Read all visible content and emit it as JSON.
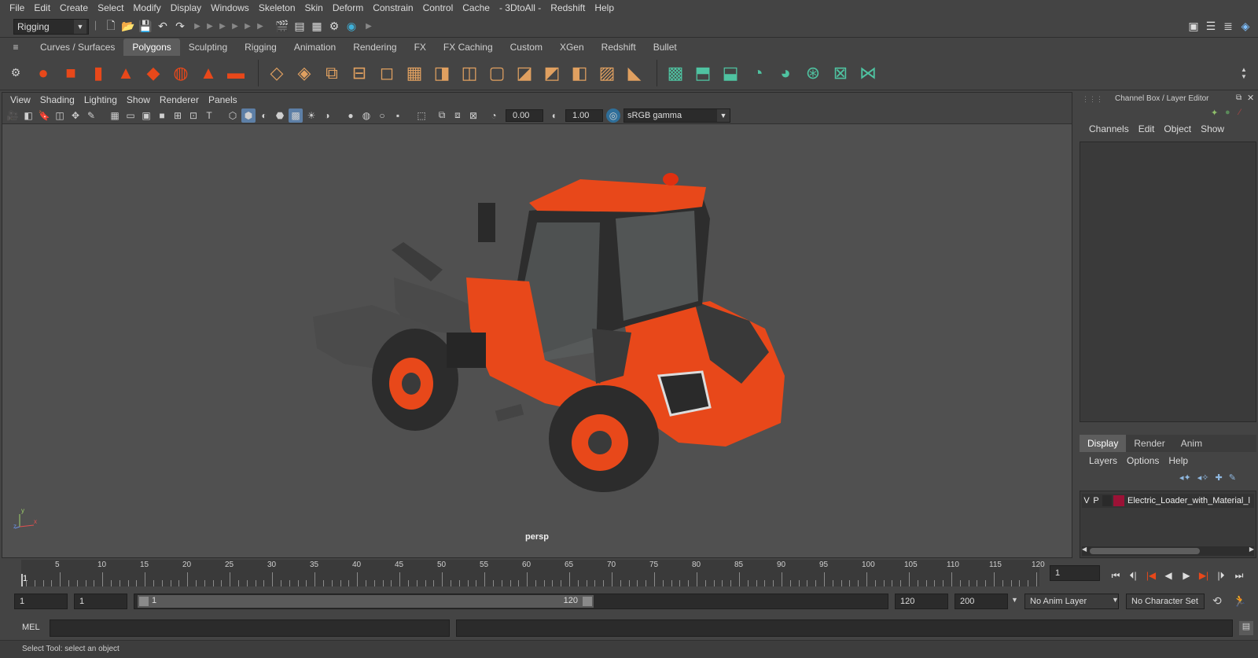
{
  "menubar": {
    "items": [
      "File",
      "Edit",
      "Create",
      "Select",
      "Modify",
      "Display",
      "Windows",
      "Skeleton",
      "Skin",
      "Deform",
      "Constrain",
      "Control",
      "Cache",
      "- 3DtoAll -",
      "Redshift",
      "Help"
    ]
  },
  "statusline": {
    "mode": "Rigging"
  },
  "shelf": {
    "tabs": [
      "Curves / Surfaces",
      "Polygons",
      "Sculpting",
      "Rigging",
      "Animation",
      "Rendering",
      "FX",
      "FX Caching",
      "Custom",
      "XGen",
      "Redshift",
      "Bullet"
    ],
    "active_tab": "Polygons",
    "icons": [
      "poly-sphere-icon",
      "poly-cube-icon",
      "poly-cylinder-icon",
      "poly-cone-icon",
      "poly-plane-icon",
      "poly-torus-icon",
      "poly-pyramid-icon",
      "poly-pipe-icon",
      "combine-icon",
      "separate-icon",
      "extrude-icon",
      "bridge-icon",
      "bevel-icon",
      "multi-cut-icon",
      "target-weld-icon",
      "edge-loop-icon",
      "merge-icon",
      "fill-hole-icon",
      "smooth-icon",
      "mirror-icon",
      "boolean-icon",
      "reduce-icon",
      "uv-editor-icon",
      "planar-map-icon",
      "cylindrical-map-icon",
      "spherical-map-icon",
      "automatic-map-icon",
      "unfold-icon",
      "layout-icon",
      "cut-sew-icon"
    ]
  },
  "viewport": {
    "menu": [
      "View",
      "Shading",
      "Lighting",
      "Show",
      "Renderer",
      "Panels"
    ],
    "exposure": "0.00",
    "gamma": "1.00",
    "colorspace": "sRGB gamma",
    "camera_label": "persp",
    "axis_y": "y",
    "axis_x": "x",
    "axis_z": "z"
  },
  "channelbox": {
    "title": "Channel Box / Layer Editor",
    "menu": [
      "Channels",
      "Edit",
      "Object",
      "Show"
    ]
  },
  "layer_editor": {
    "tabs": [
      "Display",
      "Render",
      "Anim"
    ],
    "active_tab": "Display",
    "menu": [
      "Layers",
      "Options",
      "Help"
    ],
    "layer": {
      "v": "V",
      "p": "P",
      "name": "Electric_Loader_with_Material_l",
      "color": "#9b1236"
    }
  },
  "timeline": {
    "ticks": [
      "5",
      "10",
      "15",
      "20",
      "25",
      "30",
      "35",
      "40",
      "45",
      "50",
      "55",
      "60",
      "65",
      "70",
      "75",
      "80",
      "85",
      "90",
      "95",
      "100",
      "105",
      "110",
      "115",
      "120"
    ],
    "start_marker": "1",
    "current_frame": "1"
  },
  "range": {
    "start": "1",
    "playback_start": "1",
    "slider_start": "1",
    "slider_end": "120",
    "playback_end": "120",
    "end": "200",
    "anim_layer": "No Anim Layer",
    "character_set": "No Character Set"
  },
  "cmdline": {
    "label": "MEL"
  },
  "helpline": {
    "text": "Select Tool: select an object"
  },
  "colors": {
    "loader_orange": "#e8481a",
    "accent_blue": "#5d7fa6"
  }
}
